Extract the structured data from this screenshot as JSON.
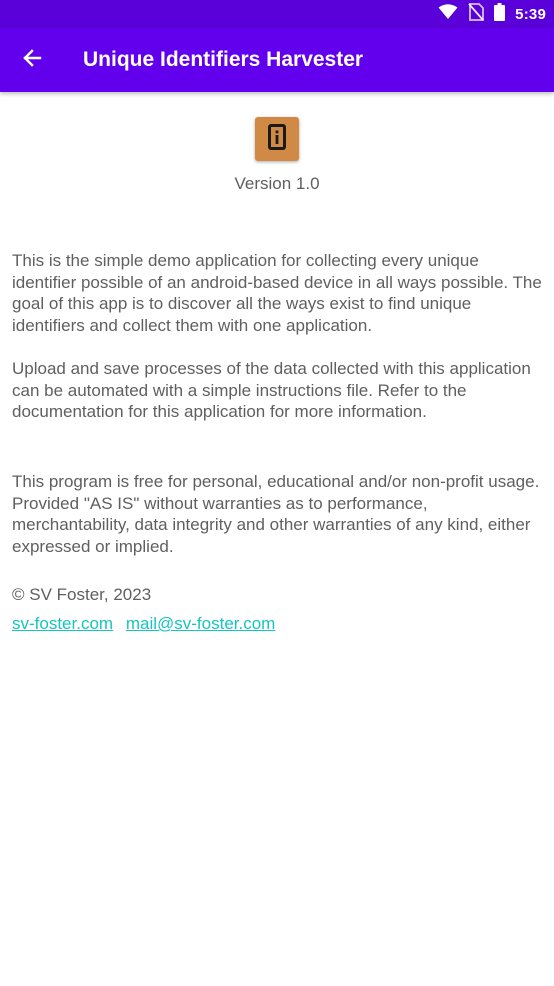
{
  "status_bar": {
    "time": "5:39",
    "icons": [
      "wifi-icon",
      "no-sim-icon",
      "battery-icon"
    ]
  },
  "app_bar": {
    "back_icon": "arrow-left-icon",
    "title": "Unique Identifiers Harvester",
    "color": "#6200ee"
  },
  "about": {
    "app_icon": "phone-info-icon",
    "version": "Version 1.0",
    "paragraphs": [
      "This is the simple demo application for collecting every unique identifier possible of an android-based device in all ways possible. The goal of this app is to discover all the ways exist to find unique identifiers and collect them with one application.",
      "Upload and save processes of the data collected with this application can be automated with a simple instructions file. Refer to the documentation for this application for more information.",
      "This program is free for personal, educational and/or non-profit usage. Provided \"AS IS\" without warranties as to performance, merchantability, data integrity and other warranties of any kind, either expressed or implied."
    ],
    "copyright": "© SV Foster, 2023",
    "links": [
      "sv-foster.com",
      "mail@sv-foster.com"
    ],
    "link_color": "#16c5bf"
  }
}
